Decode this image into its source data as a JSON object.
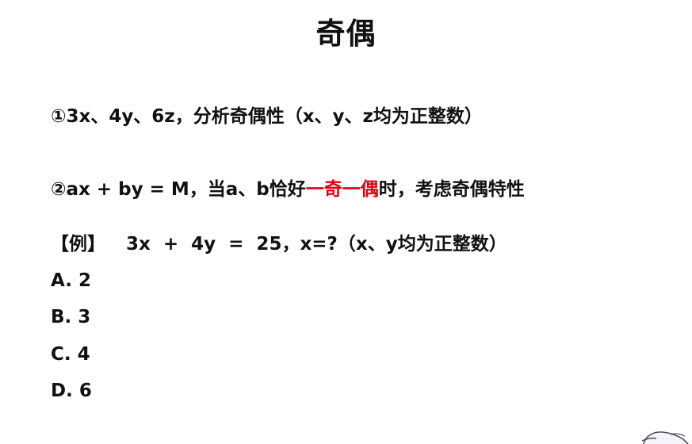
{
  "title": "奇偶",
  "point1": "①3x、4y、6z，分析奇偶性（x、y、z均为正整数）",
  "point2": {
    "before": "②ax + by = M，当a、b恰好",
    "highlight": "一奇一偶",
    "after": "时，考虑奇偶特性",
    "highlight_color": "#e60012"
  },
  "example": {
    "tag": "【例】",
    "question": "3x  +  4y  =  25，x=?（x、y均为正整数）"
  },
  "options": [
    "A. 2",
    "B. 3",
    "C. 4",
    "D. 6"
  ],
  "decoration": {
    "corner_icon": "cartoon-mascot-icon"
  }
}
